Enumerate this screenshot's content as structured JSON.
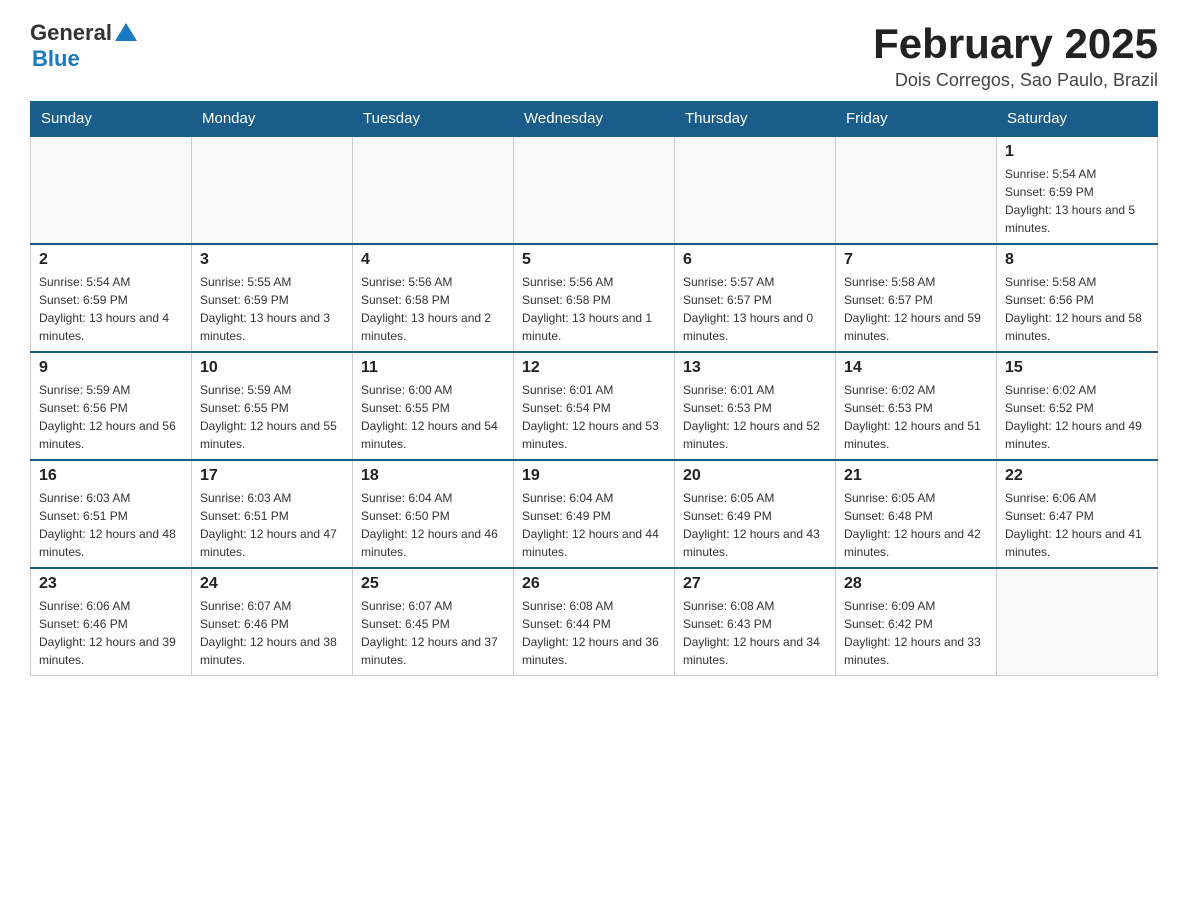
{
  "header": {
    "logo_general": "General",
    "logo_blue": "Blue",
    "month_title": "February 2025",
    "location": "Dois Corregos, Sao Paulo, Brazil"
  },
  "days_of_week": [
    "Sunday",
    "Monday",
    "Tuesday",
    "Wednesday",
    "Thursday",
    "Friday",
    "Saturday"
  ],
  "weeks": [
    [
      {
        "day": "",
        "info": ""
      },
      {
        "day": "",
        "info": ""
      },
      {
        "day": "",
        "info": ""
      },
      {
        "day": "",
        "info": ""
      },
      {
        "day": "",
        "info": ""
      },
      {
        "day": "",
        "info": ""
      },
      {
        "day": "1",
        "info": "Sunrise: 5:54 AM\nSunset: 6:59 PM\nDaylight: 13 hours and 5 minutes."
      }
    ],
    [
      {
        "day": "2",
        "info": "Sunrise: 5:54 AM\nSunset: 6:59 PM\nDaylight: 13 hours and 4 minutes."
      },
      {
        "day": "3",
        "info": "Sunrise: 5:55 AM\nSunset: 6:59 PM\nDaylight: 13 hours and 3 minutes."
      },
      {
        "day": "4",
        "info": "Sunrise: 5:56 AM\nSunset: 6:58 PM\nDaylight: 13 hours and 2 minutes."
      },
      {
        "day": "5",
        "info": "Sunrise: 5:56 AM\nSunset: 6:58 PM\nDaylight: 13 hours and 1 minute."
      },
      {
        "day": "6",
        "info": "Sunrise: 5:57 AM\nSunset: 6:57 PM\nDaylight: 13 hours and 0 minutes."
      },
      {
        "day": "7",
        "info": "Sunrise: 5:58 AM\nSunset: 6:57 PM\nDaylight: 12 hours and 59 minutes."
      },
      {
        "day": "8",
        "info": "Sunrise: 5:58 AM\nSunset: 6:56 PM\nDaylight: 12 hours and 58 minutes."
      }
    ],
    [
      {
        "day": "9",
        "info": "Sunrise: 5:59 AM\nSunset: 6:56 PM\nDaylight: 12 hours and 56 minutes."
      },
      {
        "day": "10",
        "info": "Sunrise: 5:59 AM\nSunset: 6:55 PM\nDaylight: 12 hours and 55 minutes."
      },
      {
        "day": "11",
        "info": "Sunrise: 6:00 AM\nSunset: 6:55 PM\nDaylight: 12 hours and 54 minutes."
      },
      {
        "day": "12",
        "info": "Sunrise: 6:01 AM\nSunset: 6:54 PM\nDaylight: 12 hours and 53 minutes."
      },
      {
        "day": "13",
        "info": "Sunrise: 6:01 AM\nSunset: 6:53 PM\nDaylight: 12 hours and 52 minutes."
      },
      {
        "day": "14",
        "info": "Sunrise: 6:02 AM\nSunset: 6:53 PM\nDaylight: 12 hours and 51 minutes."
      },
      {
        "day": "15",
        "info": "Sunrise: 6:02 AM\nSunset: 6:52 PM\nDaylight: 12 hours and 49 minutes."
      }
    ],
    [
      {
        "day": "16",
        "info": "Sunrise: 6:03 AM\nSunset: 6:51 PM\nDaylight: 12 hours and 48 minutes."
      },
      {
        "day": "17",
        "info": "Sunrise: 6:03 AM\nSunset: 6:51 PM\nDaylight: 12 hours and 47 minutes."
      },
      {
        "day": "18",
        "info": "Sunrise: 6:04 AM\nSunset: 6:50 PM\nDaylight: 12 hours and 46 minutes."
      },
      {
        "day": "19",
        "info": "Sunrise: 6:04 AM\nSunset: 6:49 PM\nDaylight: 12 hours and 44 minutes."
      },
      {
        "day": "20",
        "info": "Sunrise: 6:05 AM\nSunset: 6:49 PM\nDaylight: 12 hours and 43 minutes."
      },
      {
        "day": "21",
        "info": "Sunrise: 6:05 AM\nSunset: 6:48 PM\nDaylight: 12 hours and 42 minutes."
      },
      {
        "day": "22",
        "info": "Sunrise: 6:06 AM\nSunset: 6:47 PM\nDaylight: 12 hours and 41 minutes."
      }
    ],
    [
      {
        "day": "23",
        "info": "Sunrise: 6:06 AM\nSunset: 6:46 PM\nDaylight: 12 hours and 39 minutes."
      },
      {
        "day": "24",
        "info": "Sunrise: 6:07 AM\nSunset: 6:46 PM\nDaylight: 12 hours and 38 minutes."
      },
      {
        "day": "25",
        "info": "Sunrise: 6:07 AM\nSunset: 6:45 PM\nDaylight: 12 hours and 37 minutes."
      },
      {
        "day": "26",
        "info": "Sunrise: 6:08 AM\nSunset: 6:44 PM\nDaylight: 12 hours and 36 minutes."
      },
      {
        "day": "27",
        "info": "Sunrise: 6:08 AM\nSunset: 6:43 PM\nDaylight: 12 hours and 34 minutes."
      },
      {
        "day": "28",
        "info": "Sunrise: 6:09 AM\nSunset: 6:42 PM\nDaylight: 12 hours and 33 minutes."
      },
      {
        "day": "",
        "info": ""
      }
    ]
  ]
}
